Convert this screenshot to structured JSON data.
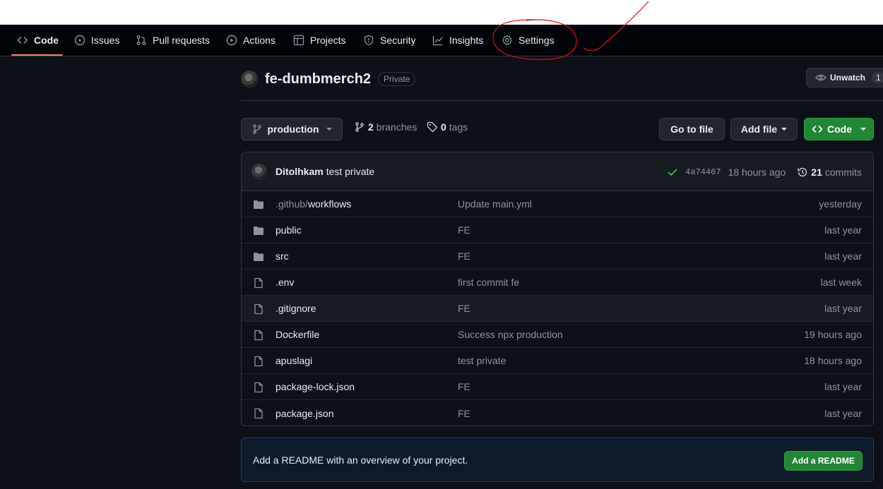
{
  "nav": {
    "tabs": [
      {
        "label": "Code",
        "icon": "code-icon"
      },
      {
        "label": "Issues",
        "icon": "issue-icon"
      },
      {
        "label": "Pull requests",
        "icon": "pull-request-icon"
      },
      {
        "label": "Actions",
        "icon": "play-icon"
      },
      {
        "label": "Projects",
        "icon": "table-icon"
      },
      {
        "label": "Security",
        "icon": "shield-icon"
      },
      {
        "label": "Insights",
        "icon": "graph-icon"
      },
      {
        "label": "Settings",
        "icon": "gear-icon"
      }
    ]
  },
  "repo": {
    "name": "fe-dumbmerch2",
    "visibility": "Private",
    "unwatch_label": "Unwatch",
    "watch_count": "1"
  },
  "toolbar": {
    "branch": "production",
    "branches_count": "2",
    "branches_label": "branches",
    "tags_count": "0",
    "tags_label": "tags",
    "go_to_file": "Go to file",
    "add_file": "Add file",
    "code": "Code"
  },
  "commit": {
    "author": "Ditolhkam",
    "message": "test private",
    "sha": "4a74467",
    "time": "18 hours ago",
    "commits_count": "21",
    "commits_label": "commits"
  },
  "files": [
    {
      "type": "folder",
      "prefix": ".github/",
      "name": "workflows",
      "message": "Update main.yml",
      "age": "yesterday"
    },
    {
      "type": "folder",
      "prefix": "",
      "name": "public",
      "message": "FE",
      "age": "last year"
    },
    {
      "type": "folder",
      "prefix": "",
      "name": "src",
      "message": "FE",
      "age": "last year"
    },
    {
      "type": "file",
      "prefix": "",
      "name": ".env",
      "message": "first commit fe",
      "age": "last week"
    },
    {
      "type": "file",
      "prefix": "",
      "name": ".gitignore",
      "message": "FE",
      "age": "last year"
    },
    {
      "type": "file",
      "prefix": "",
      "name": "Dockerfile",
      "message": "Success npx production",
      "age": "19 hours ago"
    },
    {
      "type": "file",
      "prefix": "",
      "name": "apuslagi",
      "message": "test private",
      "age": "18 hours ago"
    },
    {
      "type": "file",
      "prefix": "",
      "name": "package-lock.json",
      "message": "FE",
      "age": "last year"
    },
    {
      "type": "file",
      "prefix": "",
      "name": "package.json",
      "message": "FE",
      "age": "last year"
    }
  ],
  "readme": {
    "text": "Add a README with an overview of your project.",
    "button": "Add a README"
  },
  "colors": {
    "accent_underline": "#f78166",
    "annotation": "#e01010",
    "green_button": "#238636"
  }
}
